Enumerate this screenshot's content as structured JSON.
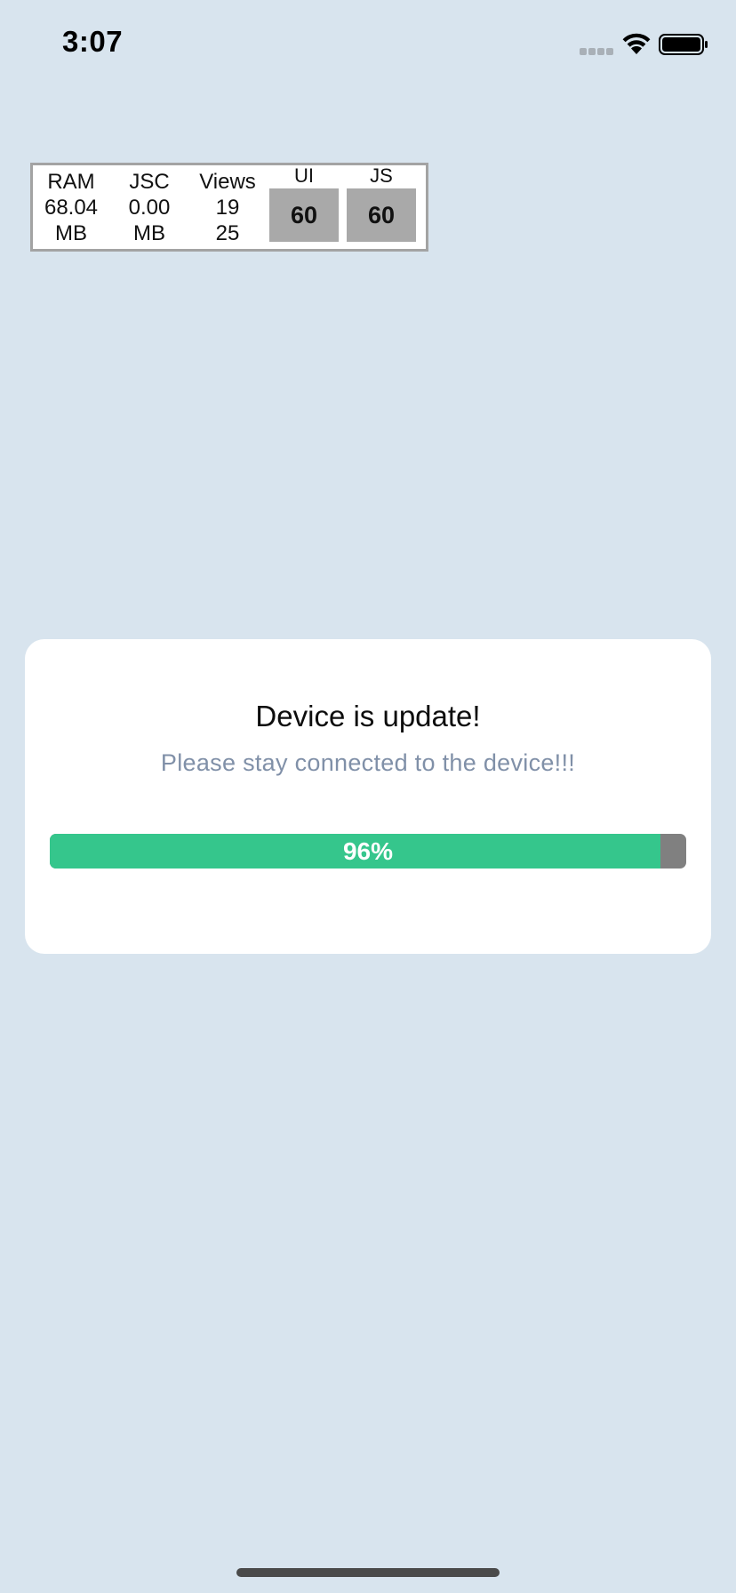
{
  "status_bar": {
    "time": "3:07"
  },
  "perf_monitor": {
    "columns": [
      {
        "header": "RAM",
        "line1": "68.04",
        "line2": "MB"
      },
      {
        "header": "JSC",
        "line1": "0.00",
        "line2": "MB"
      },
      {
        "header": "Views",
        "line1": "19",
        "line2": "25"
      }
    ],
    "fps": [
      {
        "label": "UI",
        "value": "60"
      },
      {
        "label": "JS",
        "value": "60"
      }
    ]
  },
  "update_dialog": {
    "title": "Device is update!",
    "subtitle": "Please stay connected to the device!!!",
    "progress_percent": 96,
    "progress_label": "96%"
  },
  "colors": {
    "background": "#d8e4ee",
    "progress_fill": "#35c68c",
    "progress_track": "#808080",
    "subtitle": "#8090a8"
  }
}
